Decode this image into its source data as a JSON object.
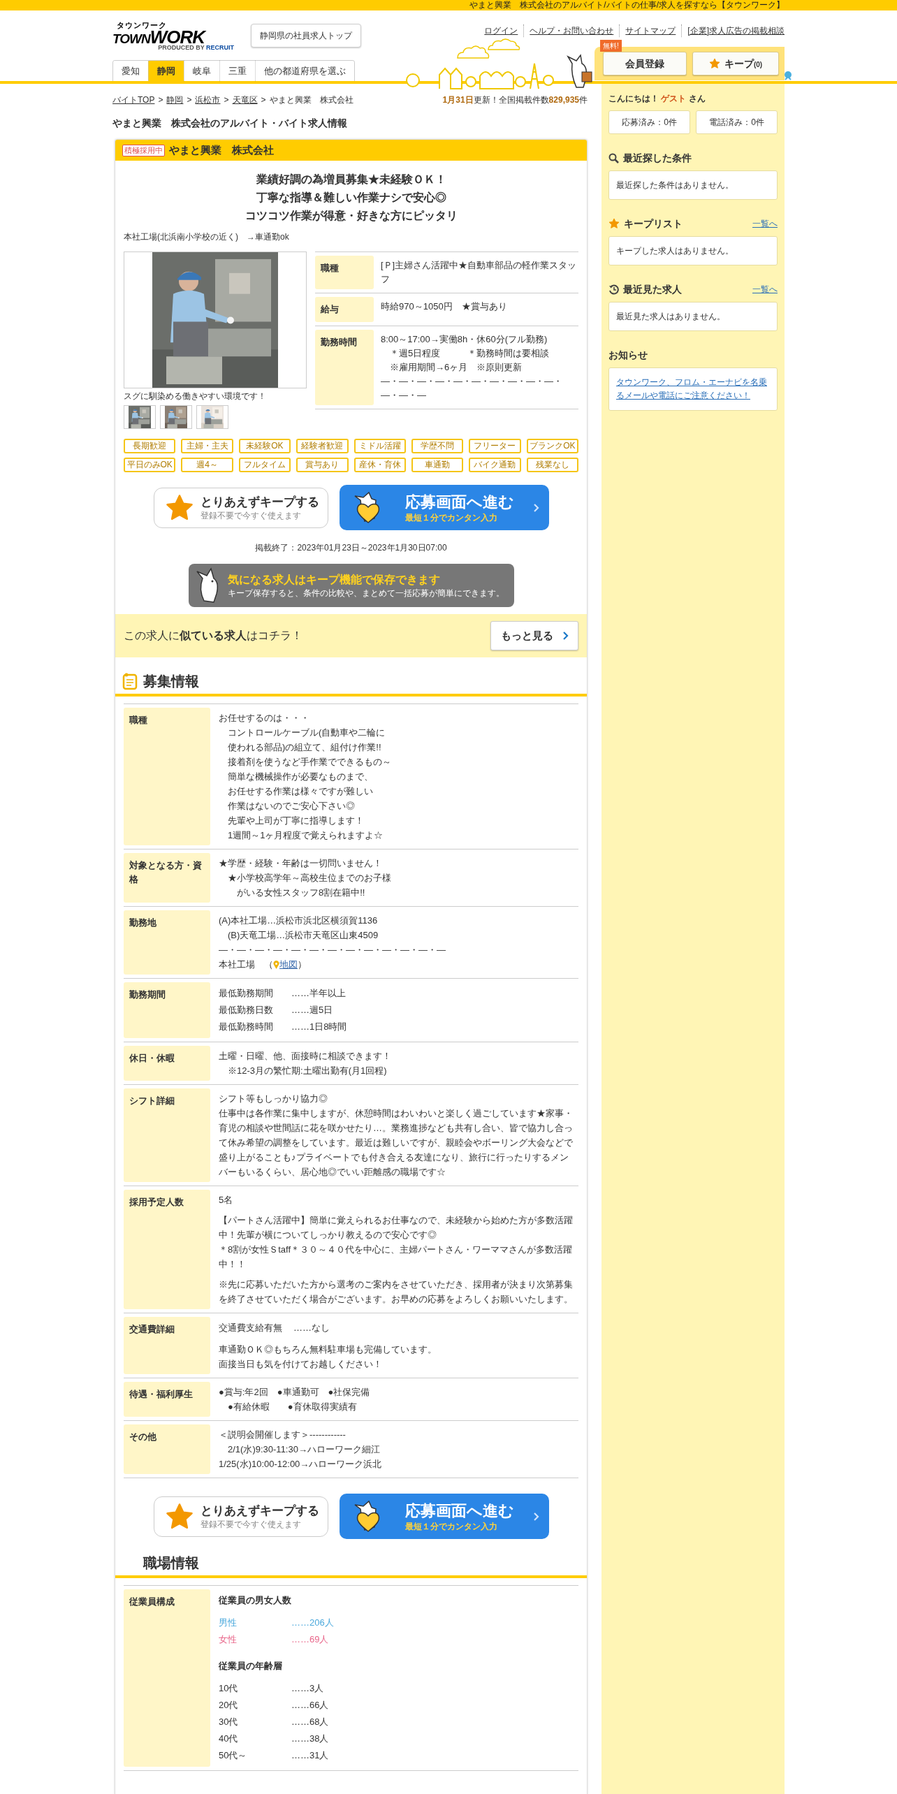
{
  "top_banner": "やまと興業　株式会社のアルバイト/バイトの仕事/求人を探すなら【タウンワーク】",
  "header": {
    "logo": {
      "kana": "タウンワーク",
      "town": "TOWN",
      "work": "WORK",
      "produced": "PRODUCED BY",
      "brand": "RECRUIT"
    },
    "top_button": "静岡県の社員求人トップ",
    "links": [
      "ログイン",
      "ヘルプ・お問い合わせ",
      "サイトマップ",
      "[企業]求人広告の掲載相談"
    ],
    "pref_tabs": [
      {
        "label": "愛知",
        "selected": false
      },
      {
        "label": "静岡",
        "selected": true
      },
      {
        "label": "岐阜",
        "selected": false
      },
      {
        "label": "三重",
        "selected": false
      },
      {
        "label": "他の都道府県を選ぶ",
        "selected": false
      }
    ],
    "member": {
      "badge": "無料!",
      "register": "会員登録",
      "keep": "キープ",
      "keep_count": "(0)"
    }
  },
  "breadcrumb": {
    "separator": ">",
    "items": [
      "バイトTOP",
      "静岡",
      "浜松市",
      "天竜区",
      "やまと興業　株式会社"
    ]
  },
  "update": {
    "date": "1月31日",
    "text": "更新！全国掲載件数",
    "count": "829,935",
    "unit": "件"
  },
  "page_title": "やまと興業　株式会社のアルバイト・バイト求人情報",
  "job": {
    "badge": "積極採用中",
    "company": "やまと興業　株式会社",
    "catch": [
      "業績好調の為増員募集★未経験ＯＫ！",
      "丁寧な指導＆難しい作業ナシで安心◎",
      "コツコツ作業が得意・好きな方にピッタリ"
    ],
    "location": "本社工場(北浜南小学校の近く)　→車通勤ok",
    "photo": {
      "kind": "picture",
      "caption": "スグに馴染める働きやすい環境です！"
    },
    "thumbnails": [
      {
        "kind": "picture"
      },
      {
        "kind": "picture"
      },
      {
        "kind": "picture"
      }
    ],
    "summary": [
      {
        "label": "職種",
        "lines": [
          "[Ｐ]主婦さん活躍中★自動車部品の軽作業スタッフ"
        ]
      },
      {
        "label": "給与",
        "lines": [
          "時給970～1050円　★賞与あり"
        ]
      },
      {
        "label": "勤務時間",
        "lines": [
          "8:00～17:00→実働8h・休60分(フル勤務)",
          "　＊週5日程度　　　＊勤務時間は要相談",
          "　※雇用期間→6ヶ月　※原則更新",
          "—・—・—・—・—・—・—・—・—・—・—・—・—"
        ]
      }
    ],
    "tags": [
      "長期歓迎",
      "主婦・主夫",
      "未経験OK",
      "経験者歓迎",
      "ミドル活躍",
      "学歴不問",
      "フリーター",
      "ブランクOK",
      "平日のみOK",
      "週4～",
      "フルタイム",
      "賞与あり",
      "産休・育休",
      "車通勤",
      "バイク通勤",
      "残業なし"
    ],
    "keep_button": {
      "title": "とりあえずキープする",
      "sub": "登録不要で今すぐ使えます"
    },
    "apply_button": {
      "title": "応募画面へ進む",
      "sub": "最短１分でカンタン入力"
    },
    "period": "掲載終了：2023年01月23日～2023年1月30日07:00",
    "promo": {
      "title": "気になる求人はキープ機能で保存できます",
      "sub": "キープ保存すると、条件の比較や、まとめて一括応募が簡単にできます。"
    },
    "similar": {
      "text": "この求人に**似ている求人**はコチラ！",
      "button": "もっと見る"
    }
  },
  "recruit": {
    "heading": "募集情報",
    "rows": [
      {
        "label": "職種",
        "blocks": [
          {
            "kind": "text",
            "lines": [
              "お任せするのは・・・",
              "　コントロールケーブル(自動車や二輪に",
              "　使われる部品)の組立て、組付け作業!!",
              "　接着剤を使うなど手作業でできるもの～",
              "　簡単な機械操作が必要なものまで、",
              "　お任せする作業は様々ですが難しい",
              "　作業はないのでご安心下さい◎",
              "　先輩や上司が丁寧に指導します！",
              "　1週間～1ヶ月程度で覚えられますよ☆"
            ]
          }
        ]
      },
      {
        "label": "対象となる方・資格",
        "blocks": [
          {
            "kind": "text",
            "lines": [
              "★学歴・経験・年齢は一切問いません！",
              "　★小学校高学年～高校生位までのお子様",
              "　　がいる女性スタッフ8割在籍中!!"
            ]
          }
        ]
      },
      {
        "label": "勤務地",
        "blocks": [
          {
            "kind": "text",
            "lines": [
              "(A)本社工場…浜松市浜北区横須賀1136",
              "　(B)天竜工場…浜松市天竜区山東4509",
              "—・—・—・—・—・—・—・—・—・—・—・—・—"
            ]
          },
          {
            "kind": "map",
            "place": "本社工場",
            "open": "（",
            "link": "地図",
            "close": "）"
          }
        ]
      },
      {
        "label": "勤務期間",
        "blocks": [
          {
            "kind": "pairs",
            "items": [
              {
                "label": "最低勤務期間",
                "value": "……半年以上"
              },
              {
                "label": "最低勤務日数",
                "value": "……週5日"
              },
              {
                "label": "最低勤務時間",
                "value": "……1日8時間"
              }
            ]
          }
        ]
      },
      {
        "label": "休日・休暇",
        "blocks": [
          {
            "kind": "text",
            "lines": [
              "土曜・日曜、他、面接時に相談できます！",
              "　※12-3月の繁忙期:土曜出勤有(月1回程)"
            ]
          }
        ]
      },
      {
        "label": "シフト詳細",
        "blocks": [
          {
            "kind": "text",
            "lines": [
              "シフト等もしっかり協力◎",
              "仕事中は各作業に集中しますが、休憩時間はわいわいと楽しく過ごしています★家事・育児の相談や世間話に花を咲かせたり…。業務進捗なども共有し合い、皆で協力し合って休み希望の調整をしています。最近は難しいですが、親睦会やボーリング大会などで盛り上がることも♪プライベートでも付き合える友達になり、旅行に行ったりするメンバーもいるくらい、居心地◎でいい距離感の職場です☆"
            ]
          }
        ]
      },
      {
        "label": "採用予定人数",
        "blocks": [
          {
            "kind": "text",
            "lines": [
              "5名"
            ]
          },
          {
            "kind": "text",
            "lines": [
              "【パートさん活躍中】簡単に覚えられるお仕事なので、未経験から始めた方が多数活躍中！先輩が横についてしっかり教えるので安心です◎",
              "＊8割が女性Ｓtaff＊３０～４０代を中心に、主婦パートさん・ワーママさんが多数活躍中！！"
            ]
          },
          {
            "kind": "text",
            "lines": [
              "※先に応募いただいた方から選考のご案内をさせていただき、採用者が決まり次第募集を終了させていただく場合がございます。お早めの応募をよろしくお願いいたします。"
            ]
          }
        ]
      },
      {
        "label": "交通費詳細",
        "blocks": [
          {
            "kind": "pairs",
            "items": [
              {
                "label": "交通費支給有無",
                "value": "……なし"
              }
            ]
          },
          {
            "kind": "text",
            "lines": [
              "車通勤ＯＫ◎もちろん無料駐車場も完備しています。",
              "面接当日も気を付けてお越しください！"
            ]
          }
        ]
      },
      {
        "label": "待遇・福利厚生",
        "blocks": [
          {
            "kind": "text",
            "lines": [
              "●賞与:年2回　●車通勤可　●社保完備",
              "　●有給休暇　　●育休取得実績有"
            ]
          }
        ]
      },
      {
        "label": "その他",
        "blocks": [
          {
            "kind": "text",
            "lines": [
              "＜説明会開催します＞------------",
              "　2/1(水)9:30-11:30→ハローワーク細江",
              "1/25(水)10:00-12:00→ハローワーク浜北"
            ]
          }
        ]
      }
    ]
  },
  "bottom_keep_button": {
    "title": "とりあえずキープする",
    "sub": "登録不要で今すぐ使えます"
  },
  "bottom_apply_button": {
    "title": "応募画面へ進む",
    "sub": "最短１分でカンタン入力"
  },
  "workplace": {
    "heading": "職場情報",
    "rows": [
      {
        "label": "従業員構成",
        "blocks": [
          {
            "kind": "subheading",
            "text": "従業員の男女人数"
          },
          {
            "kind": "pairs",
            "items": [
              {
                "label": "男性",
                "value": "……206人",
                "color": "#4aa8dc"
              },
              {
                "label": "女性",
                "value": "……69人",
                "color": "#e8668a"
              }
            ]
          },
          {
            "kind": "subheading",
            "text": "従業員の年齢層"
          },
          {
            "kind": "pairs",
            "items": [
              {
                "label": "10代",
                "value": "……3人"
              },
              {
                "label": "20代",
                "value": "……66人"
              },
              {
                "label": "30代",
                "value": "……68人"
              },
              {
                "label": "40代",
                "value": "……38人"
              },
              {
                "label": "50代～",
                "value": "……31人"
              }
            ]
          }
        ]
      }
    ]
  },
  "sidebar": {
    "greeting": {
      "hello": "こんにちは！",
      "name": "ゲスト",
      "suffix": "さん"
    },
    "stats": [
      "応募済み：0件",
      "電話済み：0件"
    ],
    "sections": [
      {
        "kind": "search",
        "title": "最近探した条件",
        "body": "最近探した条件はありません。"
      },
      {
        "kind": "star",
        "title": "キープリスト",
        "link": "一覧へ",
        "body": "キープした求人はありません。"
      },
      {
        "kind": "history",
        "title": "最近見た求人",
        "link": "一覧へ",
        "body": "最近見た求人はありません。"
      },
      {
        "kind": "notice",
        "title": "お知らせ",
        "notice": "タウンワーク、フロム・エーナビを名乗るメールや電話にご注意ください！"
      }
    ]
  }
}
